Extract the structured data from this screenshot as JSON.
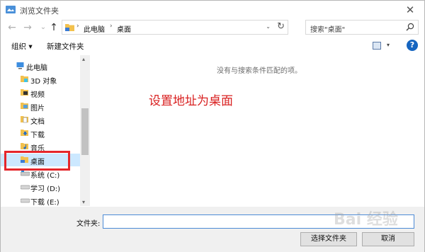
{
  "window": {
    "title": "浏览文件夹",
    "close_glyph": "✕"
  },
  "nav": {
    "back_glyph": "←",
    "forward_glyph": "→",
    "recent_glyph": "⌄",
    "up_glyph": "↑"
  },
  "address": {
    "segments": [
      "此电脑",
      "桌面"
    ],
    "sep_glyph": "›",
    "dropdown_glyph": "⌄",
    "refresh_glyph": "↻"
  },
  "search": {
    "text": "搜索\"桌面\""
  },
  "toolbar": {
    "organize": "组织 ▾",
    "new_folder": "新建文件夹",
    "view_drop_glyph": "▾",
    "help": "?"
  },
  "sidebar": {
    "items": [
      {
        "label": "此电脑",
        "icon": "computer-icon"
      },
      {
        "label": "3D 对象",
        "icon": "3d-objects-icon"
      },
      {
        "label": "视频",
        "icon": "video-icon"
      },
      {
        "label": "图片",
        "icon": "pictures-icon"
      },
      {
        "label": "文档",
        "icon": "documents-icon"
      },
      {
        "label": "下载",
        "icon": "download-icon"
      },
      {
        "label": "音乐",
        "icon": "music-icon"
      },
      {
        "label": "桌面",
        "icon": "desktop-icon"
      },
      {
        "label": "系统 (C:)",
        "icon": "drive-icon"
      },
      {
        "label": "学习 (D:)",
        "icon": "drive-icon"
      },
      {
        "label": "下载 (E:)",
        "icon": "drive-icon"
      }
    ],
    "selected_index": 7,
    "scroll_up_glyph": "▴",
    "scroll_down_glyph": "▾"
  },
  "main": {
    "empty_message": "没有与搜索条件匹配的项。",
    "annotation": "设置地址为桌面"
  },
  "bottom": {
    "folder_label": "文件夹:",
    "folder_value": "",
    "select_button": "选择文件夹",
    "cancel_button": "取消"
  },
  "watermark": "Bai 经验",
  "colors": {
    "accent": "#1565c0",
    "selection": "#cce8ff",
    "highlight_border": "#e5262b",
    "annotation": "#d92121"
  }
}
